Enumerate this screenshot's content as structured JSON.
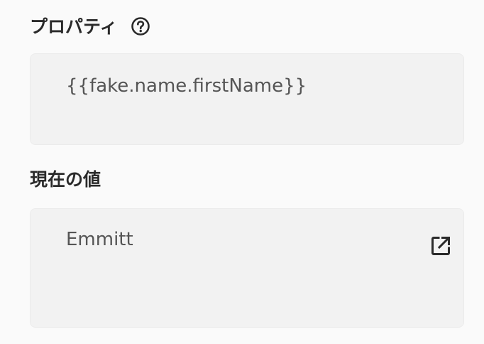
{
  "property": {
    "label": "プロパティ",
    "help_icon": "question-circle-icon",
    "value": "{{fake.name.firstName}}"
  },
  "current": {
    "label": "現在の値",
    "value": "Emmitt",
    "open_icon": "open-in-new-icon"
  }
}
